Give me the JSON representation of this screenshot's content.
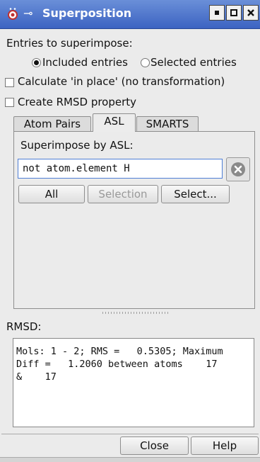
{
  "window": {
    "title": "Superposition"
  },
  "entries": {
    "label": "Entries to superimpose:",
    "included_label": "Included entries",
    "selected_label": "Selected entries"
  },
  "options": {
    "in_place_label": "Calculate 'in place' (no transformation)",
    "rmsd_property_label": "Create RMSD property"
  },
  "tabs": [
    {
      "label": "Atom Pairs"
    },
    {
      "label": "ASL"
    },
    {
      "label": "SMARTS"
    }
  ],
  "asl": {
    "heading": "Superimpose by ASL:",
    "value": "not atom.element H",
    "buttons": {
      "all": "All",
      "selection": "Selection",
      "select": "Select..."
    }
  },
  "rmsd": {
    "label": "RMSD:",
    "text": "Mols: 1 - 2; RMS =   0.5305; Maximum\nDiff =   1.2060 between atoms    17\n&    17"
  },
  "footer": {
    "close": "Close",
    "help": "Help"
  },
  "colors": {
    "titlebar": "#3c63c2",
    "input_border": "#4f7ed6",
    "window_bg": "#ebebeb"
  }
}
